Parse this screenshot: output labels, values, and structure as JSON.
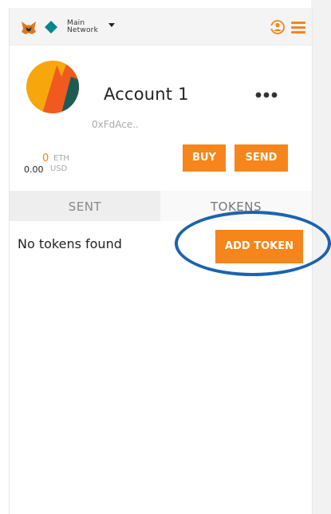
{
  "header": {
    "network_line1": "Main",
    "network_line2": "Network",
    "icons": {
      "logo": "metamask-fox-icon",
      "network": "network-diamond-icon",
      "account_switch": "account-switch-icon",
      "menu": "hamburger-menu-icon"
    }
  },
  "account": {
    "name": "Account 1",
    "address": "0xFdAce..",
    "balance_eth": "0",
    "eth_unit": "ETH",
    "balance_usd": "0.00",
    "usd_unit": "USD"
  },
  "actions": {
    "buy": "BUY",
    "send": "SEND"
  },
  "tabs": [
    {
      "label": "SENT",
      "active": false
    },
    {
      "label": "TOKENS",
      "active": true
    }
  ],
  "tokens": {
    "empty_message": "No tokens found",
    "add_button": "ADD TOKEN"
  },
  "colors": {
    "accent": "#f6851b",
    "network": "#038789",
    "highlight": "#1a63b0"
  }
}
